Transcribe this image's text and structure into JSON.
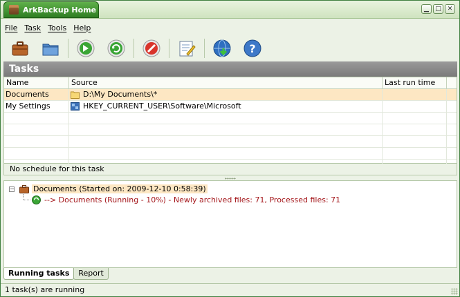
{
  "window": {
    "title": "ArkBackup Home",
    "app_icon": "backup-box-icon",
    "controls": [
      "minimize-icon",
      "maximize-icon",
      "close-icon"
    ]
  },
  "menu": [
    {
      "label": "File"
    },
    {
      "label": "Task"
    },
    {
      "label": "Tools"
    },
    {
      "label": "Help"
    }
  ],
  "toolbar": [
    {
      "icon": "briefcase-icon"
    },
    {
      "icon": "folder-icon"
    },
    {
      "icon": "run-icon"
    },
    {
      "icon": "refresh-icon"
    },
    {
      "icon": "stop-icon"
    },
    {
      "icon": "edit-icon"
    },
    {
      "icon": "globe-download-icon"
    },
    {
      "icon": "help-icon"
    }
  ],
  "tasks": {
    "header": "Tasks",
    "columns": [
      "Name",
      "Source",
      "Last run time"
    ],
    "rows": [
      {
        "name": "Documents",
        "source": "D:\\My Documents\\*",
        "last_run": "",
        "icon": "folder-icon",
        "selected": true
      },
      {
        "name": "My Settings",
        "source": "HKEY_CURRENT_USER\\Software\\Microsoft",
        "last_run": "",
        "icon": "registry-icon",
        "selected": false
      }
    ],
    "schedule_text": "No schedule for this task"
  },
  "running": {
    "parent": "Documents (Started on: 2009-12-10 0:58:39)",
    "child": "--> Documents (Running - 10%) - Newly archived files: 71, Processed files: 71",
    "expander": "−"
  },
  "tabs": [
    {
      "label": "Running tasks",
      "active": true
    },
    {
      "label": "Report",
      "active": false
    }
  ],
  "status": "1 task(s) are running",
  "colors": {
    "accent": "#2f7e22",
    "selected_row": "#fde7c3",
    "log_text": "#a4161a"
  }
}
